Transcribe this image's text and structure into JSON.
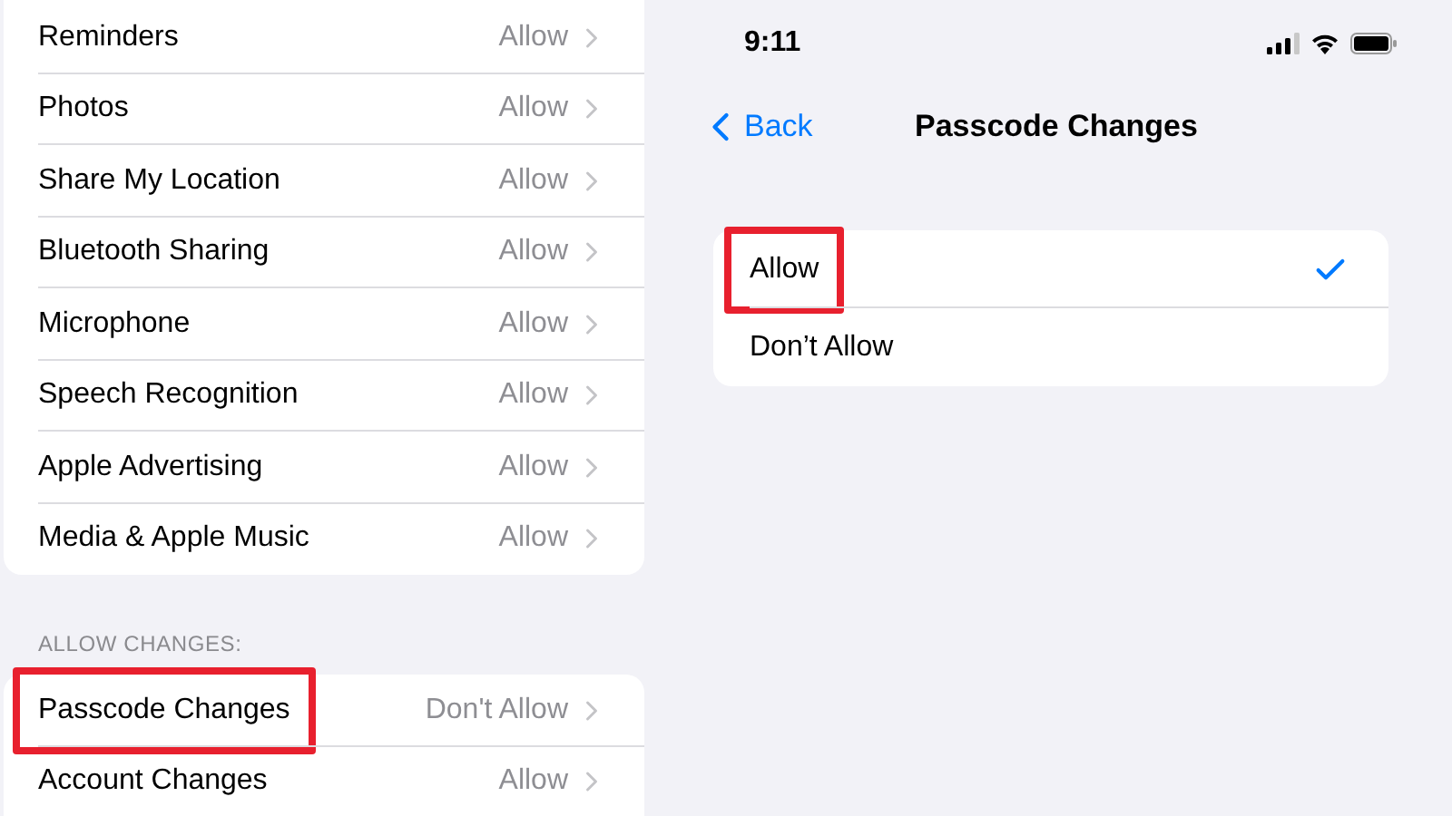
{
  "left_panel": {
    "rows": [
      {
        "label": "Reminders",
        "value": "Allow"
      },
      {
        "label": "Photos",
        "value": "Allow"
      },
      {
        "label": "Share My Location",
        "value": "Allow"
      },
      {
        "label": "Bluetooth Sharing",
        "value": "Allow"
      },
      {
        "label": "Microphone",
        "value": "Allow"
      },
      {
        "label": "Speech Recognition",
        "value": "Allow"
      },
      {
        "label": "Apple Advertising",
        "value": "Allow"
      },
      {
        "label": "Media & Apple Music",
        "value": "Allow"
      }
    ],
    "section_header": "ALLOW CHANGES:",
    "section_rows": [
      {
        "label": "Passcode Changes",
        "value": "Don't Allow",
        "highlighted": true
      },
      {
        "label": "Account Changes",
        "value": "Allow",
        "highlighted": false
      }
    ]
  },
  "right_panel": {
    "status_bar": {
      "time": "9:11"
    },
    "nav": {
      "back": "Back",
      "title": "Passcode Changes"
    },
    "options": [
      {
        "label": "Allow",
        "selected": true,
        "highlighted": true
      },
      {
        "label": "Don’t Allow",
        "selected": false,
        "highlighted": false
      }
    ]
  }
}
